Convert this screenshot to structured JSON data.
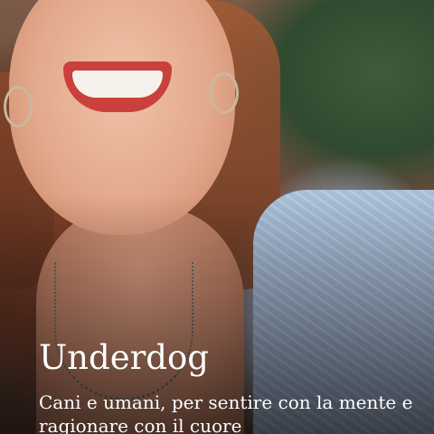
{
  "card": {
    "image_alt": "portrait of a smiling woman",
    "title": "Underdog",
    "subtitle": "Cani e umani, per sentire con la mente e ragionare con il cuore"
  },
  "colors": {
    "text": "#ffffff",
    "cardigan": "#a8bfd8"
  }
}
